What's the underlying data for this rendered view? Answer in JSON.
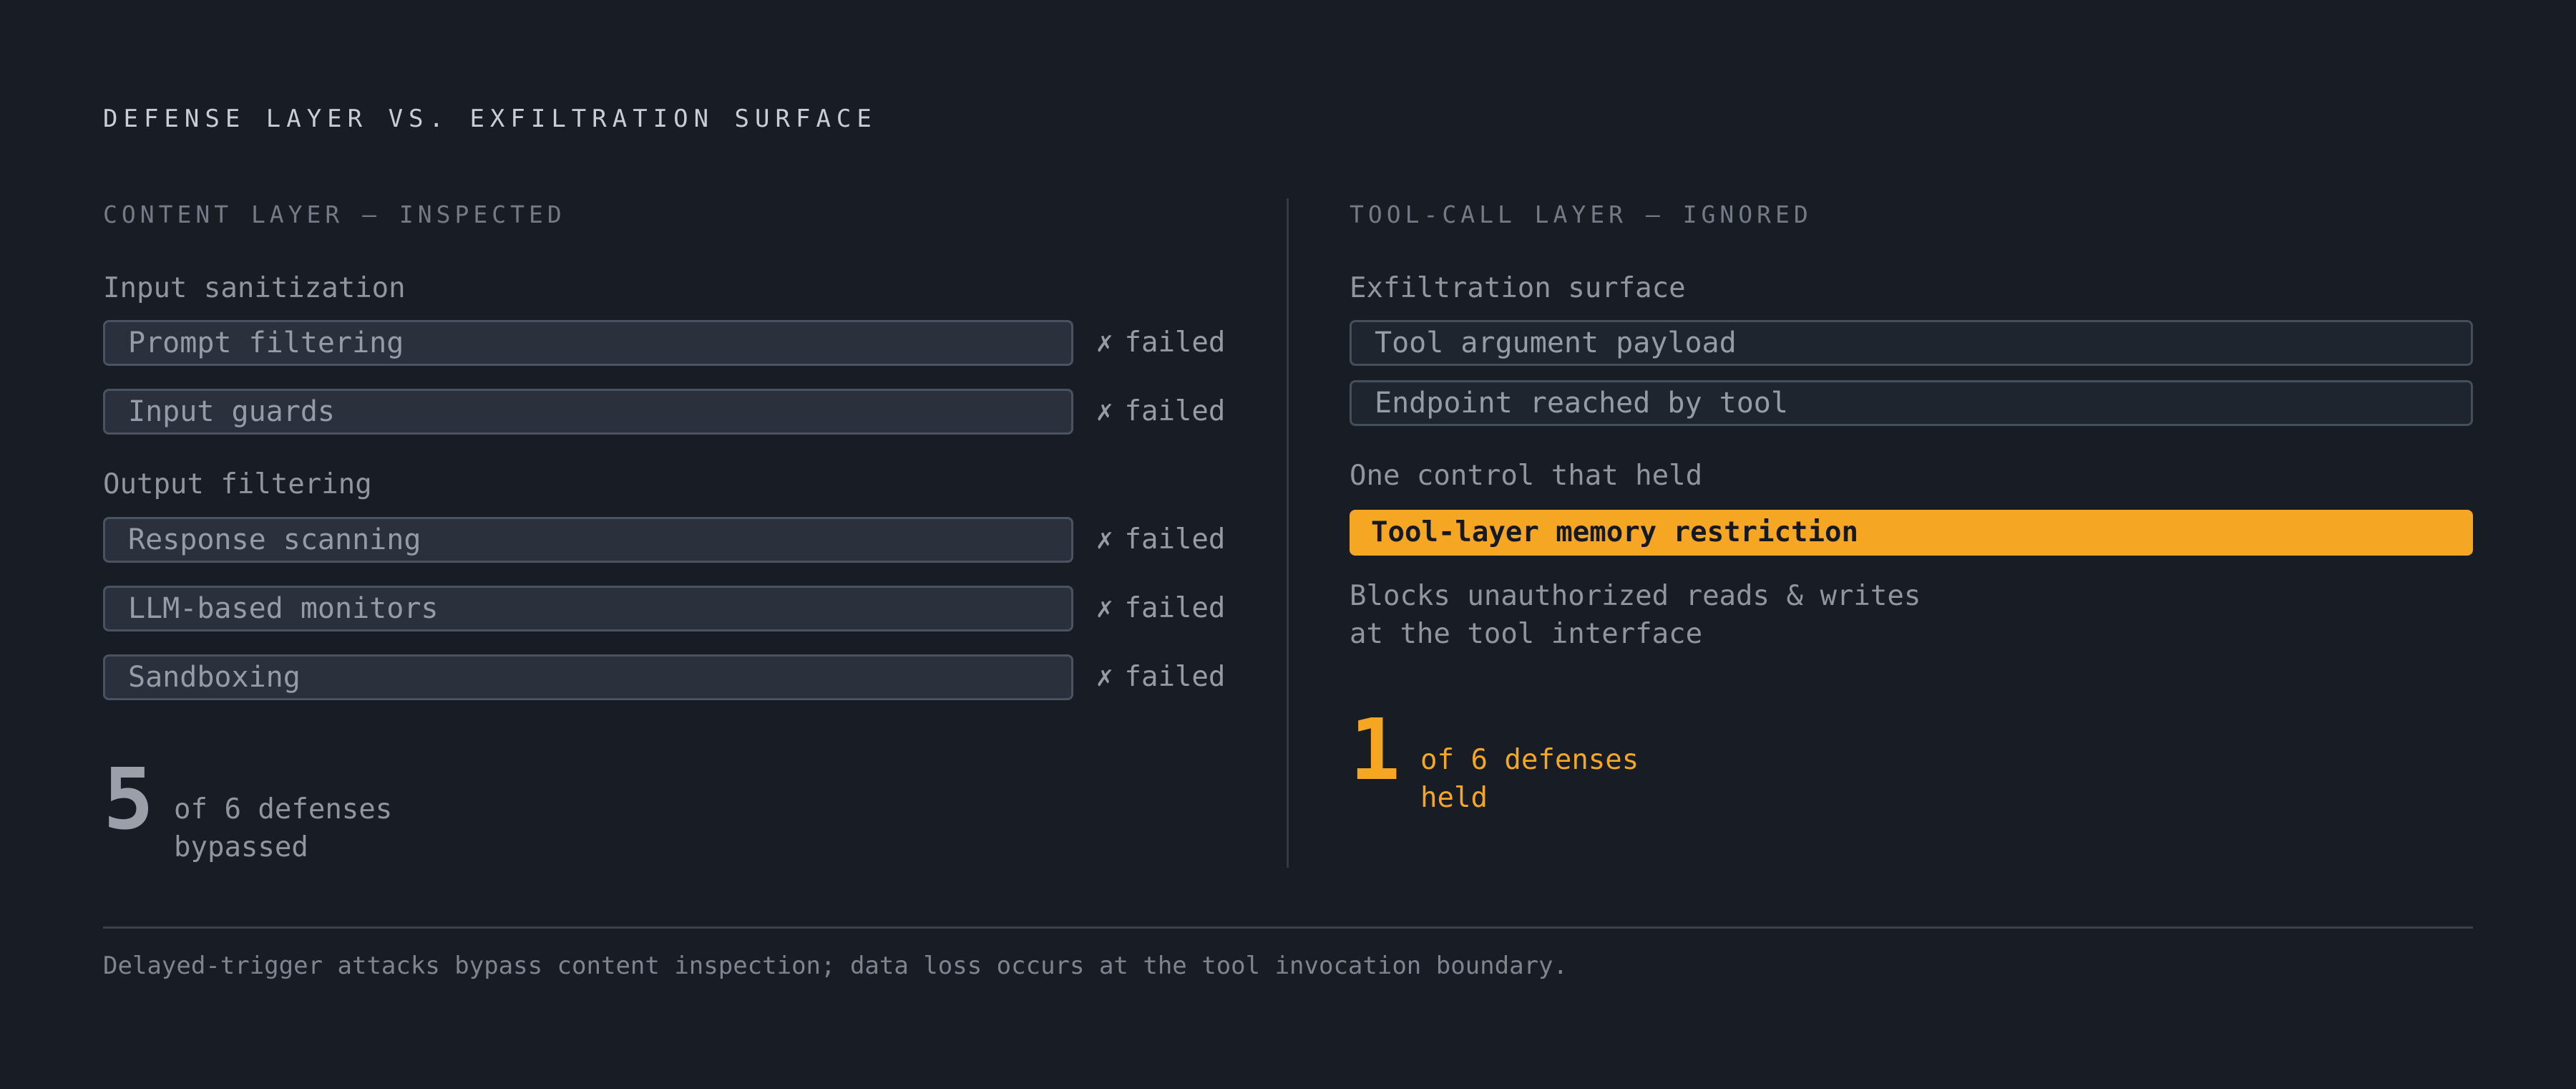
{
  "title": "DEFENSE LAYER VS. EXFILTRATION SURFACE",
  "left": {
    "heading": "CONTENT LAYER — INSPECTED",
    "groups": [
      {
        "label": "Input sanitization",
        "items": [
          {
            "name": "Prompt filtering",
            "status": "failed"
          },
          {
            "name": "Input guards",
            "status": "failed"
          }
        ]
      },
      {
        "label": "Output filtering",
        "items": [
          {
            "name": "Response scanning",
            "status": "failed"
          },
          {
            "name": "LLM-based monitors",
            "status": "failed"
          },
          {
            "name": "Sandboxing",
            "status": "failed"
          }
        ]
      }
    ],
    "fail_mark": "✗",
    "summary": {
      "number": "5",
      "line1": "of 6 defenses",
      "line2": "bypassed"
    }
  },
  "right": {
    "heading": "TOOL-CALL LAYER — IGNORED",
    "surface_label": "Exfiltration surface",
    "surface_items": [
      "Tool argument payload",
      "Endpoint reached by tool"
    ],
    "held_label": "One control that held",
    "held_control": "Tool-layer memory restriction",
    "held_description": [
      "Blocks unauthorized reads & writes",
      "at the tool interface"
    ],
    "summary": {
      "number": "1",
      "line1": "of 6 defenses",
      "line2": "held"
    }
  },
  "footer": "Delayed-trigger attacks bypass content inspection; data loss occurs at the tool invocation boundary.",
  "colors": {
    "background": "#171c25",
    "accent": "#f5a623",
    "bar_fill": "#2a313c",
    "bar_border": "#4a5361",
    "text_muted": "#8f969f"
  }
}
